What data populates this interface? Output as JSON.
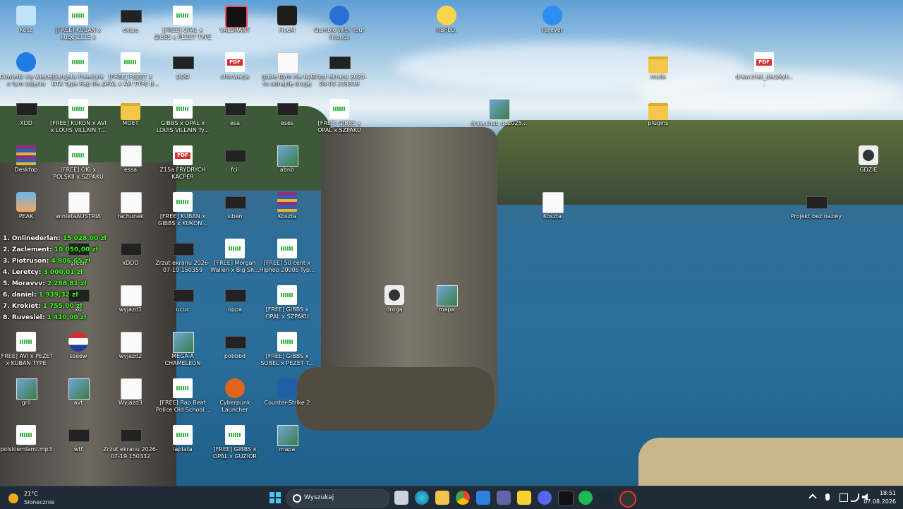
{
  "desktop_icons": [
    {
      "id": "kosz",
      "label": "Kosz",
      "type": "recycle"
    },
    {
      "id": "i1",
      "label": "[FREE] KUBAN x kuqe 2115 x SOBEL...",
      "type": "audio"
    },
    {
      "id": "i2",
      "label": "ekipa",
      "type": "dark"
    },
    {
      "id": "i3",
      "label": "[FREE] OPAL x GIBBS x PEZET TYPE BEA...",
      "type": "audio"
    },
    {
      "id": "i4",
      "label": "VALORANT",
      "type": "valorant"
    },
    {
      "id": "i5",
      "label": "FiveM",
      "type": "fivem"
    },
    {
      "id": "i6",
      "label": "Gamble With Your Friends",
      "type": "gamble"
    },
    {
      "id": "i7",
      "label": "RBPLQ.",
      "type": "emoji"
    },
    {
      "id": "i8",
      "label": "Farever",
      "type": "farever"
    },
    {
      "id": "i9",
      "label": "Dowiedz się więcej o tym zdjęciu",
      "type": "info"
    },
    {
      "id": "i10",
      "label": "Gangsta Freestyle GTA Type Rap Be...",
      "type": "audio"
    },
    {
      "id": "i11",
      "label": "[FREE] PEZET x OPAL x AVI TYPE B...",
      "type": "audio"
    },
    {
      "id": "i12",
      "label": "DDD",
      "type": "dark"
    },
    {
      "id": "i13",
      "label": "chorwacja",
      "type": "pdf"
    },
    {
      "id": "i14",
      "label": "gdzie Bym nie był to odnajdę drogę",
      "type": "doc"
    },
    {
      "id": "i15",
      "label": "Zrzut ekranu 2025-08-03 233339",
      "type": "dark"
    },
    {
      "id": "i16",
      "label": "mods",
      "type": "folder"
    },
    {
      "id": "i17",
      "label": "draw.chat_deczkyk...",
      "type": "pdf"
    },
    {
      "id": "i18",
      "label": "XDD",
      "type": "dark"
    },
    {
      "id": "i19",
      "label": "[FREE] KUKON x AVI x LOUIS VILLAIN T...",
      "type": "audio"
    },
    {
      "id": "i20",
      "label": "MOET",
      "type": "folder"
    },
    {
      "id": "i21",
      "label": "GIBBS x OPAL x LOUIS VILLAIN Ty...",
      "type": "audio"
    },
    {
      "id": "i22",
      "label": "esa",
      "type": "dark"
    },
    {
      "id": "i23",
      "label": "eses",
      "type": "dark"
    },
    {
      "id": "i24",
      "label": "[FREE] GIBBS x OPAL x SZPAKU Type Be...",
      "type": "audio"
    },
    {
      "id": "i25",
      "label": "draw.chat_dc2025...",
      "type": "img"
    },
    {
      "id": "i26",
      "label": "plugins",
      "type": "folder"
    },
    {
      "id": "i27",
      "label": "Desktop",
      "type": "rar"
    },
    {
      "id": "i28",
      "label": "[FREE] OKI x POLSKII x SZPAKU TYPE BE...",
      "type": "audio"
    },
    {
      "id": "i29",
      "label": "essa",
      "type": "doc"
    },
    {
      "id": "i30",
      "label": "Z15a FRYDRYCH KACPER",
      "type": "pdf"
    },
    {
      "id": "i31",
      "label": "fcii",
      "type": "dark"
    },
    {
      "id": "i32",
      "label": "abnb",
      "type": "img"
    },
    {
      "id": "i33",
      "label": "GDZIE",
      "type": "video"
    },
    {
      "id": "i34",
      "label": "PEAK",
      "type": "peak"
    },
    {
      "id": "i35",
      "label": "winietaAUSTRIA",
      "type": "doc"
    },
    {
      "id": "i36",
      "label": "rachunek",
      "type": "doc"
    },
    {
      "id": "i37",
      "label": "[FREE] KUBAN x GIBBS x KUKON...",
      "type": "audio"
    },
    {
      "id": "i38",
      "label": "siben",
      "type": "dark"
    },
    {
      "id": "i39",
      "label": "Koszta",
      "type": "rar"
    },
    {
      "id": "i40",
      "label": "Koszta",
      "type": "doc"
    },
    {
      "id": "i41",
      "label": "Projekt bez nazwy",
      "type": "dark"
    },
    {
      "id": "i42",
      "label": "green",
      "type": "dark"
    },
    {
      "id": "i43",
      "label": "xDDD",
      "type": "dark"
    },
    {
      "id": "i44",
      "label": "Zrzut ekranu 2026-07-19 150359",
      "type": "dark"
    },
    {
      "id": "i45",
      "label": "[FREE] Morgan Wallen x Big Sh...",
      "type": "audio"
    },
    {
      "id": "i46",
      "label": "[FREE] 50 cent x Hiphop 2000s Typ...",
      "type": "audio"
    },
    {
      "id": "i47",
      "label": "droga",
      "type": "video"
    },
    {
      "id": "i48",
      "label": "mapa",
      "type": "img"
    },
    {
      "id": "i49",
      "label": "xd",
      "type": "dark"
    },
    {
      "id": "i50",
      "label": "wyjazd1",
      "type": "doc"
    },
    {
      "id": "i51",
      "label": "ucuc",
      "type": "dark"
    },
    {
      "id": "i52",
      "label": "oppa",
      "type": "dark"
    },
    {
      "id": "i53",
      "label": "[FREE] GIBBS x OPAL x SZPAKU Type B...",
      "type": "audio"
    },
    {
      "id": "i54",
      "label": "[FREE] AVI x PEZET x KUBAN TYPE BEA...",
      "type": "audio"
    },
    {
      "id": "i55",
      "label": "sseew",
      "type": "flag"
    },
    {
      "id": "i56",
      "label": "wyjazd2",
      "type": "doc"
    },
    {
      "id": "i57",
      "label": "MEGA-A CHAMELEON",
      "type": "img"
    },
    {
      "id": "i58",
      "label": "pobbbd",
      "type": "dark"
    },
    {
      "id": "i59",
      "label": "[FREE] GIBBS x SOBEL x PEZET T...",
      "type": "audio"
    },
    {
      "id": "i60",
      "label": "gril",
      "type": "img"
    },
    {
      "id": "i61",
      "label": "avt",
      "type": "img"
    },
    {
      "id": "i62",
      "label": "Wyjazd3",
      "type": "doc"
    },
    {
      "id": "i63",
      "label": "[FREE] Rap Beat Police Old School...",
      "type": "audio"
    },
    {
      "id": "i64",
      "label": "Cyberpunk Launcher",
      "type": "cyber"
    },
    {
      "id": "i65",
      "label": "Counter-Strike 2",
      "type": "cs2"
    },
    {
      "id": "i66",
      "label": "polskiemiami.mp3",
      "type": "audio"
    },
    {
      "id": "i67",
      "label": "wtf",
      "type": "dark"
    },
    {
      "id": "i68",
      "label": "Zrzut ekranu 2026-07-19 150332",
      "type": "dark"
    },
    {
      "id": "i69",
      "label": "laplata",
      "type": "audio"
    },
    {
      "id": "i70",
      "label": "[FREE] GIBBS x OPAL x GUZIOR Type be...",
      "type": "audio"
    },
    {
      "id": "i71",
      "label": "mapa",
      "type": "img"
    }
  ],
  "leaderboard": [
    {
      "rank_name": "1. Onlinederlan:",
      "amount": "15 028,00 zł"
    },
    {
      "rank_name": "2. Zaclement:",
      "amount": "10 050,00 zł"
    },
    {
      "rank_name": "3. Piotruson:",
      "amount": "4 806,65 zł"
    },
    {
      "rank_name": "4. Leretcy:",
      "amount": "3 000,01 zł"
    },
    {
      "rank_name": "5. Moravvv:",
      "amount": "2 288,81 zł"
    },
    {
      "rank_name": "6. daniel:",
      "amount": "1 939,32 zł"
    },
    {
      "rank_name": "7. Krokiet:",
      "amount": "1 755,00 zł"
    },
    {
      "rank_name": "8. Ruvesiel:",
      "amount": "1 410,00 zł"
    }
  ],
  "taskbar": {
    "weather_temp": "21°C",
    "weather_cond": "Słonecznie",
    "search_placeholder": "Wyszukaj",
    "time": "18:51",
    "date": "07.08.2026"
  }
}
